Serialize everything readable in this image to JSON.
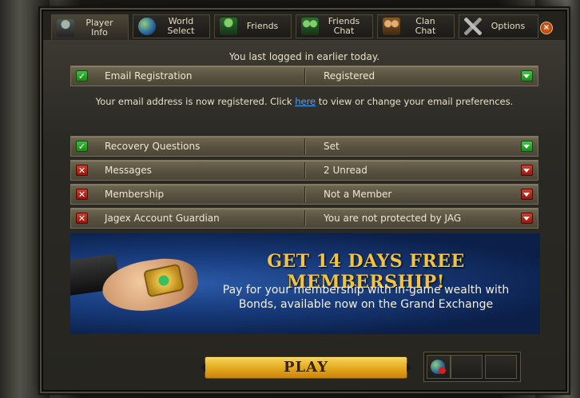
{
  "tabs": [
    {
      "id": "player-info",
      "label": "Player\nInfo",
      "line1": "Player",
      "line2": "Info",
      "icon": "player-icon",
      "active": true
    },
    {
      "id": "world-select",
      "line1": "World",
      "line2": "Select",
      "icon": "world-icon"
    },
    {
      "id": "friends",
      "line1": "Friends",
      "line2": "",
      "icon": "friends-icon"
    },
    {
      "id": "friends-chat",
      "line1": "Friends",
      "line2": "Chat",
      "icon": "friends-chat-icon"
    },
    {
      "id": "clan-chat",
      "line1": "Clan",
      "line2": "Chat",
      "icon": "clan-chat-icon"
    },
    {
      "id": "options",
      "line1": "Options",
      "line2": "",
      "icon": "options-icon"
    }
  ],
  "close_label": "×",
  "last_login": "You last logged in earlier today.",
  "email_row": {
    "name": "Email Registration",
    "value": "Registered",
    "status": "ok"
  },
  "email_note": {
    "before": "Your email address is now registered. Click ",
    "link": "here",
    "after": " to view or change your email preferences."
  },
  "status_rows": [
    {
      "name": "Recovery Questions",
      "value": "Set",
      "status": "ok"
    },
    {
      "name": "Messages",
      "value": "2 Unread",
      "status": "bad"
    },
    {
      "name": "Membership",
      "value": "Not a Member",
      "status": "bad"
    },
    {
      "name": "Jagex Account Guardian",
      "value": "You are not protected by JAG",
      "status": "bad"
    }
  ],
  "banner": {
    "headline": "GET 14 DAYS FREE MEMBERSHIP!",
    "line1": "Pay for your membership with in-game wealth with",
    "line2": "Bonds, available now on the Grand Exchange"
  },
  "play_label": "PLAY",
  "colors": {
    "accent_gold": "#f1c341",
    "ok_green": "#3fbf3f",
    "bad_red": "#d43a28",
    "link_blue": "#4aa0ff"
  }
}
